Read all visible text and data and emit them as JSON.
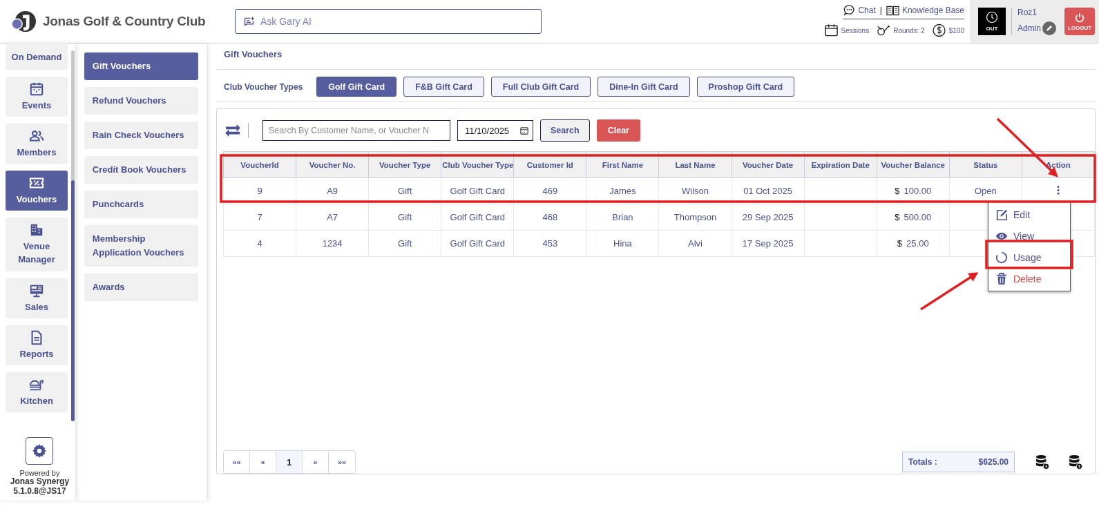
{
  "header": {
    "title": "Jonas Golf & Country Club",
    "ask_field": {
      "placeholder": "Ask Gary AI"
    },
    "chat": "Chat",
    "separator": "|",
    "knowledge_base": "Knowledge Base",
    "sessions": "Sessions",
    "rounds": "Rounds: 2",
    "balance": "$100",
    "clock_button": "OUT",
    "user": "Roz1",
    "role": "Admin",
    "logout_button": "LOGOUT"
  },
  "sidebar": {
    "items": [
      {
        "label": "On Demand",
        "kind": "on-demand",
        "selected": false
      },
      {
        "label": "Events",
        "kind": "events",
        "selected": false
      },
      {
        "label": "Members",
        "kind": "members",
        "selected": false
      },
      {
        "label": "Vouchers",
        "kind": "vouchers",
        "selected": true
      },
      {
        "label": "Venue Manager",
        "kind": "venue",
        "selected": false
      },
      {
        "label": "Sales",
        "kind": "sales",
        "selected": false
      },
      {
        "label": "Reports",
        "kind": "reports",
        "selected": false
      },
      {
        "label": "Kitchen",
        "kind": "kitchen",
        "selected": false
      }
    ],
    "powered_by": "Powered by",
    "product": "Jonas Synergy",
    "version": "5.1.0.8@JS17"
  },
  "submenu": {
    "items": [
      {
        "label": "Gift Vouchers",
        "selected": true
      },
      {
        "label": "Refund Vouchers",
        "selected": false
      },
      {
        "label": "Rain Check Vouchers",
        "selected": false
      },
      {
        "label": "Credit Book Vouchers",
        "selected": false
      },
      {
        "label": "Punchcards",
        "selected": false
      },
      {
        "label": "Membership Application Vouchers",
        "selected": false
      },
      {
        "label": "Awards",
        "selected": false
      }
    ]
  },
  "page_title": "Gift Vouchers",
  "voucher_types": {
    "label": "Club Voucher Types",
    "items": [
      {
        "label": "Golf Gift Card",
        "selected": true
      },
      {
        "label": "F&B Gift Card",
        "selected": false
      },
      {
        "label": "Full Club Gift Card",
        "selected": false
      },
      {
        "label": "Dine-In Gift Card",
        "selected": false
      },
      {
        "label": "Proshop Gift Card",
        "selected": false
      }
    ]
  },
  "filters": {
    "search": {
      "placeholder": "Search By Customer Name, or Voucher N"
    },
    "date": {
      "value": "11/10/2025"
    },
    "search_button": "Search",
    "clear_button": "Clear"
  },
  "table": {
    "columns": [
      "VoucherId",
      "Voucher No.",
      "Voucher Type",
      "Club Voucher Type",
      "Customer Id",
      "First Name",
      "Last Name",
      "Voucher Date",
      "Expiration Date",
      "Voucher Balance",
      "Status",
      "Action"
    ],
    "rows": [
      {
        "voucher_id": "9",
        "voucher_no": "A9",
        "voucher_type": "Gift",
        "club_voucher_type": "Golf Gift Card",
        "customer_id": "469",
        "first_name": "James",
        "last_name": "Wilson",
        "voucher_date": "01 Oct 2025",
        "currency": "$",
        "amount": "100.00",
        "status": "Open"
      },
      {
        "voucher_id": "7",
        "voucher_no": "A7",
        "voucher_type": "Gift",
        "club_voucher_type": "Golf Gift Card",
        "customer_id": "468",
        "first_name": "Brian",
        "last_name": "Thompson",
        "voucher_date": "29 Sep 2025",
        "currency": "$",
        "amount": "500.00"
      },
      {
        "voucher_id": "4",
        "voucher_no": "1234",
        "voucher_type": "Gift",
        "club_voucher_type": "Golf Gift Card",
        "customer_id": "453",
        "first_name": "Hina",
        "last_name": "Alvi",
        "voucher_date": "17 Sep 2025",
        "currency": "$",
        "amount": "25.00"
      }
    ]
  },
  "action_menu": {
    "items": [
      {
        "label": "Edit",
        "kind": "edit"
      },
      {
        "label": "View",
        "kind": "view"
      },
      {
        "label": "Usage",
        "kind": "usage"
      },
      {
        "label": "Delete",
        "kind": "delete"
      }
    ]
  },
  "pagination": {
    "items": [
      {
        "label": "««",
        "selected": false
      },
      {
        "label": "«",
        "selected": false
      },
      {
        "label": "1",
        "selected": true
      },
      {
        "label": "»",
        "selected": false
      },
      {
        "label": "»»",
        "selected": false
      }
    ]
  },
  "totals": {
    "label": "Totals :",
    "value": "$625.00"
  }
}
